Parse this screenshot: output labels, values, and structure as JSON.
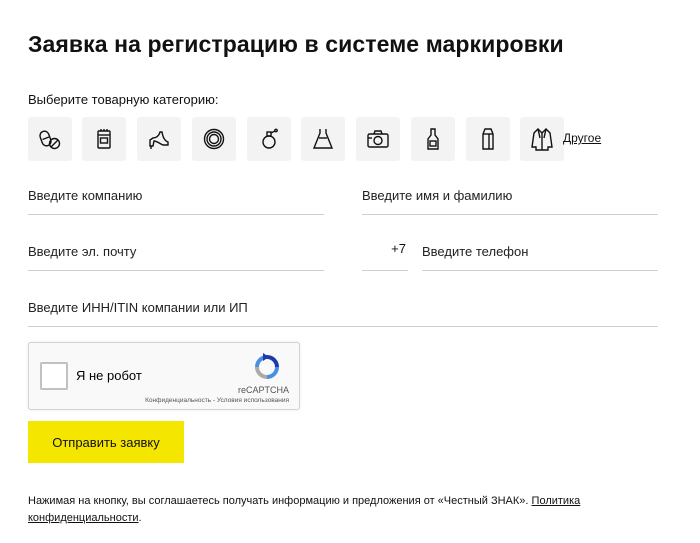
{
  "page": {
    "title": "Заявка на регистрацию в системе маркировки"
  },
  "categories": {
    "label": "Выберите товарную категорию:",
    "other_label": "Другое",
    "icons": [
      "pills-icon",
      "tobacco-pack-icon",
      "high-heel-shoe-icon",
      "tire-icon",
      "perfume-bottle-icon",
      "dress-icon",
      "camera-icon",
      "beer-bottle-icon",
      "milk-carton-icon",
      "fur-coat-icon"
    ]
  },
  "form": {
    "company_placeholder": "Введите компанию",
    "name_placeholder": "Введите имя и фамилию",
    "email_placeholder": "Введите эл. почту",
    "phone_prefix": "+7",
    "phone_placeholder": "Введите телефон",
    "inn_placeholder": "Введите ИНН/ITIN компании или ИП"
  },
  "captcha": {
    "label": "Я не робот",
    "brand": "reCAPTCHA",
    "links": "Конфиденциальность - Условия использования"
  },
  "submit_label": "Отправить заявку",
  "consent": {
    "text": "Нажимая на кнопку, вы соглашаетесь получать информацию и предложения от «Честный ЗНАК». ",
    "link": "Политика конфиденциальности",
    "end": "."
  },
  "colors": {
    "accent": "#f5e600",
    "icon_bg": "#f3f3f3"
  }
}
